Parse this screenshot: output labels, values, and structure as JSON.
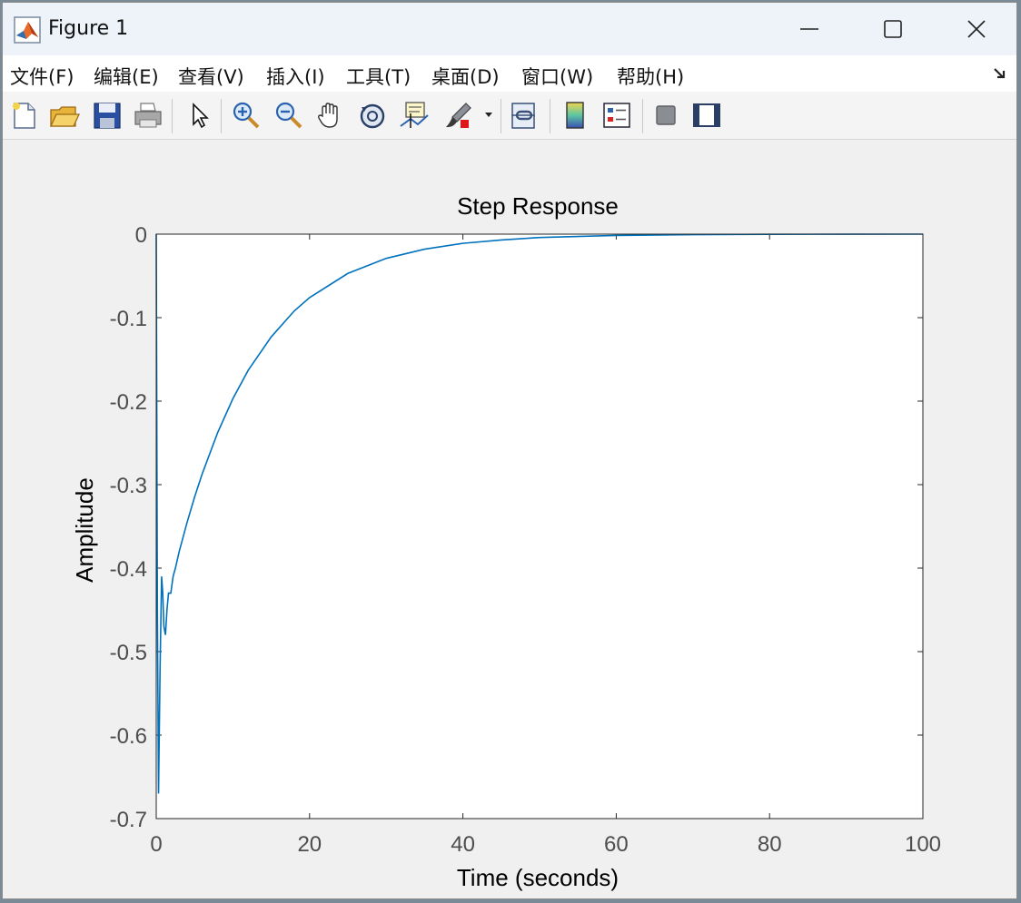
{
  "window": {
    "title": "Figure 1"
  },
  "menu": [
    {
      "name": "file",
      "label": "文件(F)"
    },
    {
      "name": "edit",
      "label": "编辑(E)"
    },
    {
      "name": "view",
      "label": "查看(V)"
    },
    {
      "name": "insert",
      "label": "插入(I)"
    },
    {
      "name": "tools",
      "label": "工具(T)"
    },
    {
      "name": "desktop",
      "label": "桌面(D)"
    },
    {
      "name": "window",
      "label": "窗口(W)"
    },
    {
      "name": "help",
      "label": "帮助(H)"
    }
  ],
  "toolbar": [
    "new-figure-icon",
    "open-file-icon",
    "save-icon",
    "print-icon",
    "pointer-icon",
    "zoom-in-icon",
    "zoom-out-icon",
    "pan-hand-icon",
    "rotate-3d-icon",
    "data-cursor-icon",
    "brush-icon",
    "link-plot-icon",
    "colorbar-icon",
    "legend-icon",
    "hide-plot-tools-icon",
    "show-plot-tools-icon"
  ],
  "chart_data": {
    "type": "line",
    "title": "Step Response",
    "xlabel": "Time (seconds)",
    "ylabel": "Amplitude",
    "xlim": [
      0,
      100
    ],
    "ylim": [
      -0.7,
      0
    ],
    "xticks": [
      "0",
      "20",
      "40",
      "60",
      "80",
      "100"
    ],
    "yticks": [
      "0",
      "-0.1",
      "-0.2",
      "-0.3",
      "-0.4",
      "-0.5",
      "-0.6",
      "-0.7"
    ],
    "line_color": "#0072bd",
    "reference_line": 0,
    "series": [
      {
        "x": [
          0,
          0.15,
          0.3,
          0.5,
          0.7,
          0.85,
          1.0,
          1.2,
          1.4,
          1.6,
          1.9,
          2.2,
          2.5,
          3,
          4,
          5,
          6,
          8,
          10,
          12,
          15,
          18,
          20,
          25,
          30,
          35,
          40,
          45,
          50,
          60,
          70,
          80,
          90,
          100
        ],
        "y": [
          0,
          -0.45,
          -0.67,
          -0.52,
          -0.41,
          -0.43,
          -0.47,
          -0.48,
          -0.45,
          -0.43,
          -0.43,
          -0.41,
          -0.4,
          -0.38,
          -0.346,
          -0.315,
          -0.287,
          -0.238,
          -0.197,
          -0.163,
          -0.123,
          -0.092,
          -0.076,
          -0.047,
          -0.029,
          -0.018,
          -0.011,
          -0.007,
          -0.004,
          -0.0016,
          -0.0006,
          -0.0002,
          -0.0001,
          0
        ]
      }
    ]
  }
}
